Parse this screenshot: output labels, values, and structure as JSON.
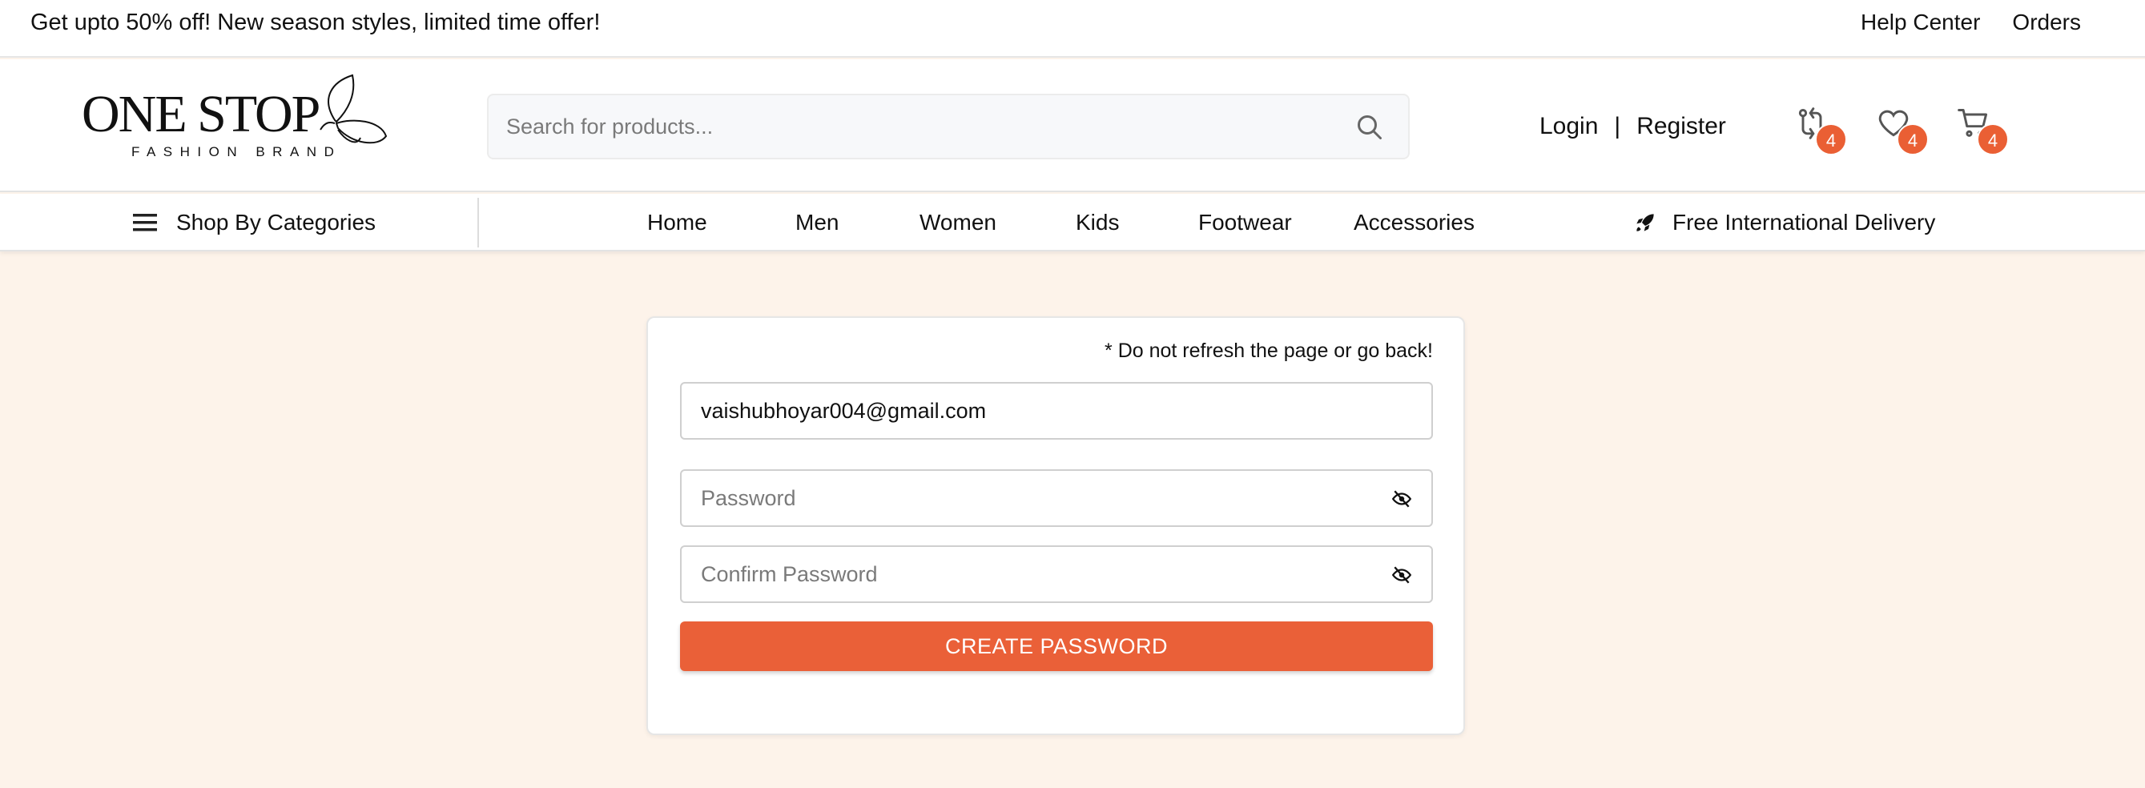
{
  "topbar": {
    "promo": "Get upto 50% off! New season styles, limited time offer!",
    "help_center": "Help Center",
    "orders": "Orders"
  },
  "header": {
    "logo_text": "ONE STOP",
    "logo_subtext": "FASHION BRAND",
    "search_placeholder": "Search for products...",
    "login": "Login",
    "separator": "|",
    "register": "Register",
    "compare_count": "4",
    "wishlist_count": "4",
    "cart_count": "4"
  },
  "nav": {
    "categories_label": "Shop By Categories",
    "links": [
      "Home",
      "Men",
      "Women",
      "Kids",
      "Footwear",
      "Accessories"
    ],
    "delivery": "Free International Delivery"
  },
  "form": {
    "notice": "* Do not refresh the page or go back!",
    "email_value": "vaishubhoyar004@gmail.com",
    "password_placeholder": "Password",
    "confirm_placeholder": "Confirm Password",
    "submit_label": "CREATE PASSWORD"
  },
  "colors": {
    "accent": "#ea6038",
    "page_bg": "#fdf3ea"
  }
}
